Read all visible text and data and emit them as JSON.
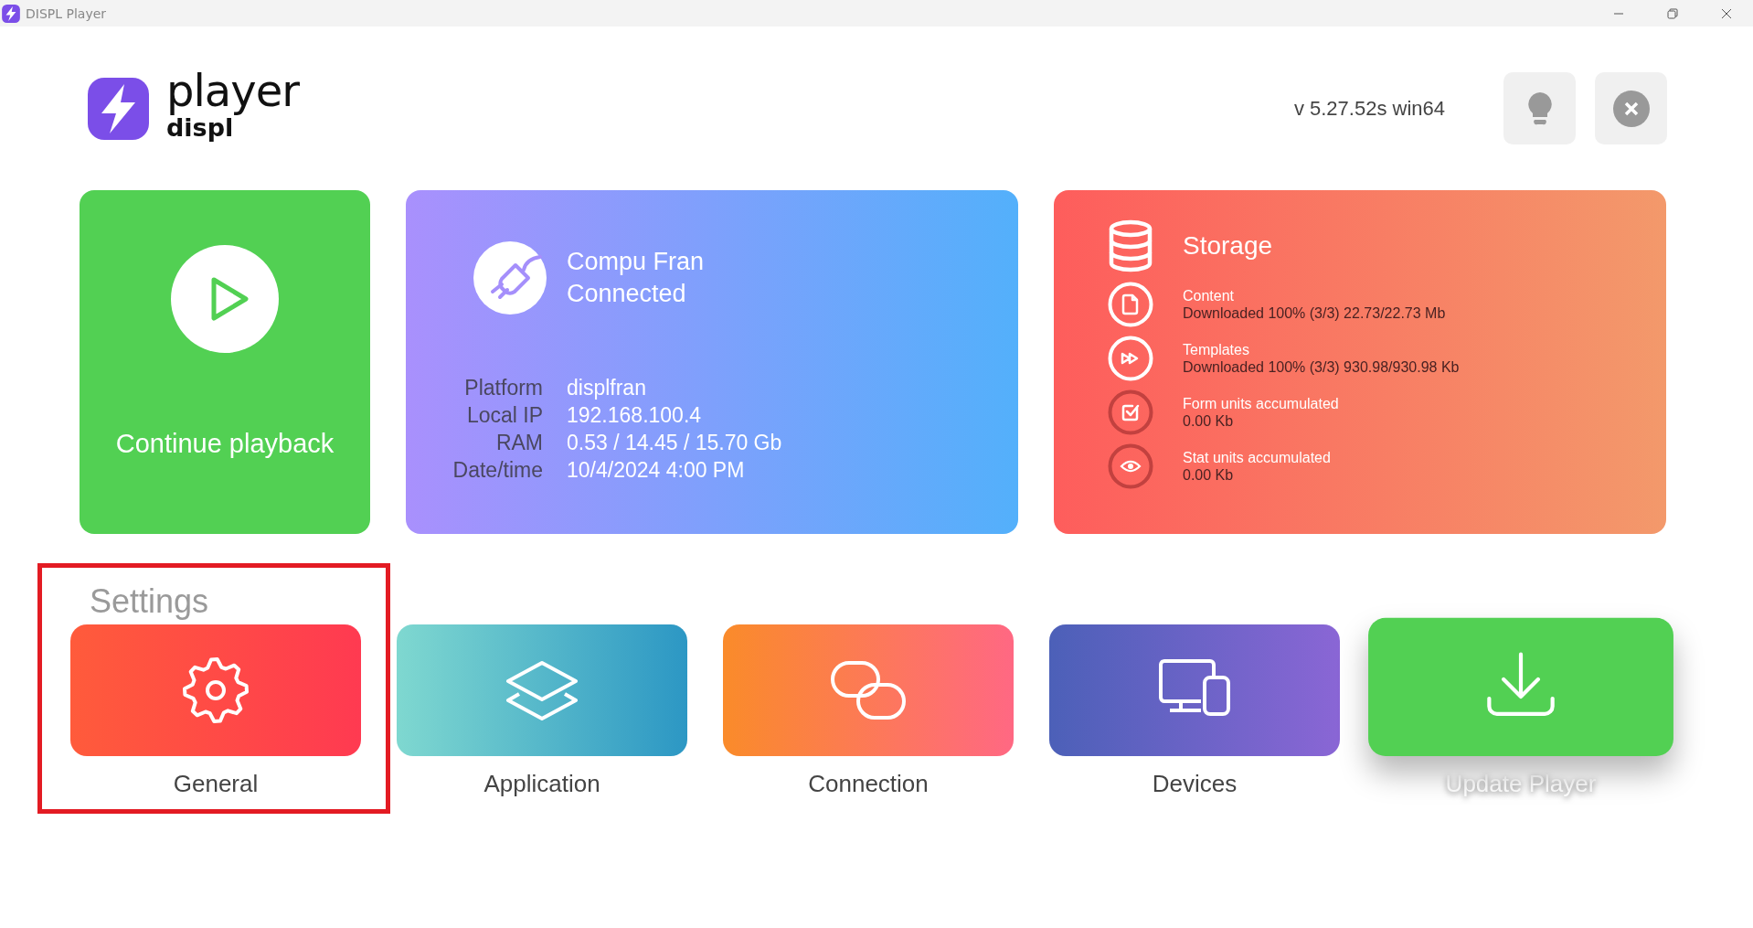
{
  "window": {
    "title": "DISPL Player"
  },
  "logo": {
    "product": "player",
    "brand": "displ"
  },
  "version": "v 5.27.52s win64",
  "playback_card": {
    "label": "Continue playback"
  },
  "connection_card": {
    "name": "Compu Fran",
    "status": "Connected",
    "details": [
      {
        "label": "Platform",
        "value": "displfran"
      },
      {
        "label": "Local IP",
        "value": "192.168.100.4"
      },
      {
        "label": "RAM",
        "value": "0.53 / 14.45 / 15.70 Gb"
      },
      {
        "label": "Date/time",
        "value": "10/4/2024 4:00 PM"
      }
    ]
  },
  "storage_card": {
    "title": "Storage",
    "items": [
      {
        "kind": "content",
        "title": "Content",
        "value": "Downloaded 100% (3/3) 22.73/22.73 Mb",
        "complete": true
      },
      {
        "kind": "templates",
        "title": "Templates",
        "value": "Downloaded 100% (3/3) 930.98/930.98 Kb",
        "complete": true
      },
      {
        "kind": "forms",
        "title": "Form units accumulated",
        "value": "0.00 Kb",
        "complete": false
      },
      {
        "kind": "stats",
        "title": "Stat units accumulated",
        "value": "0.00 Kb",
        "complete": false
      }
    ]
  },
  "settings": {
    "title": "Settings",
    "highlighted": true,
    "tiles": [
      {
        "kind": "general",
        "label": "General",
        "hovered": false
      },
      {
        "kind": "application",
        "label": "Application",
        "hovered": false
      },
      {
        "kind": "connection",
        "label": "Connection",
        "hovered": false
      },
      {
        "kind": "devices",
        "label": "Devices",
        "hovered": false
      },
      {
        "kind": "update",
        "label": "Update Player",
        "hovered": true
      }
    ]
  }
}
